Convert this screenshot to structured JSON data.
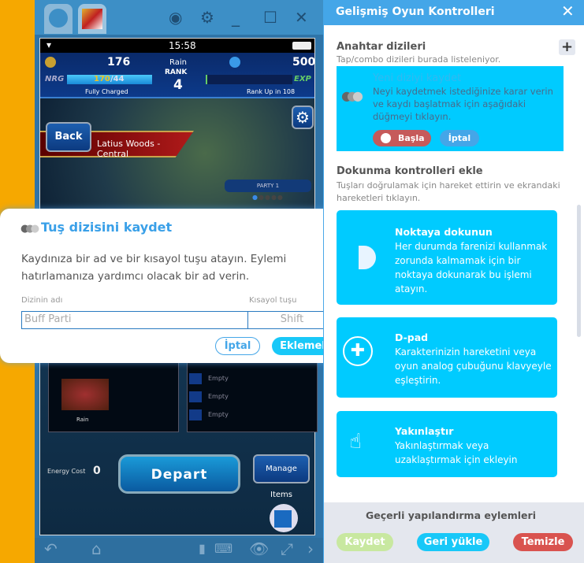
{
  "emulator": {
    "icons": [
      "home-icon",
      "app-icon",
      "account-icon",
      "gear-icon",
      "minimize-icon",
      "maximize-icon",
      "close-icon"
    ],
    "bottom_icons": [
      "back-icon",
      "home-icon",
      "location-icon",
      "keyboard-icon",
      "eye-icon",
      "fullscreen-icon",
      "chevron-right-icon"
    ]
  },
  "game": {
    "time": "15:58",
    "gil": "176",
    "player": "Rain",
    "rank_label": "RANK",
    "rank": "4",
    "gems": "500",
    "nrg_label": "NRG",
    "nrg_value": "170",
    "nrg_max": "/44",
    "nrg_status": "Fully Charged",
    "exp_label": "EXP",
    "rank_up": "Rank Up in 108",
    "back": "Back",
    "location": "Latius Woods - Central",
    "party": "PARTY 1",
    "slots": [
      "Empty",
      "Empty",
      "Empty",
      "Empty"
    ],
    "unit_name": "Rain",
    "energy_cost_label": "Energy Cost",
    "energy_cost": "0",
    "depart": "Depart",
    "manage_items": "Manage Items"
  },
  "dialog": {
    "title": "Tuş dizisini kaydet",
    "body": "Kaydınıza bir ad ve bir kısayol tuşu atayın. Eylemi hatırlamanıza yardımcı olacak bir ad verin.",
    "name_label": "Dizinin adı",
    "name_value": "Buff Parti",
    "shortcut_label": "Kısayol tuşu",
    "shortcut_value": "Shift",
    "cancel": "İptal",
    "add": "Eklemek"
  },
  "panel": {
    "title": "Gelişmiş Oyun Kontrolleri",
    "seq_title": "Anahtar dizileri",
    "seq_sub": "Tap/combo dizileri burada listeleniyor.",
    "rec_title": "Yeni diziyi kaydet",
    "rec_desc": "Neyi kaydetmek istediğinize karar verin ve kaydı başlatmak için aşağıdaki düğmeyi tıklayın.",
    "start": "Başla",
    "cancel": "İptal",
    "touch_title": "Dokunma kontrolleri ekle",
    "touch_sub": "Tuşları doğrulamak için hareket ettirin ve ekrandaki hareketleri tıklayın.",
    "cards": [
      {
        "title": "Noktaya dokunun",
        "desc": "Her durumda farenizi kullanmak zorunda kalmamak için bir noktaya dokunarak bu işlemi atayın.",
        "icon": "tap-point-icon"
      },
      {
        "title": "D-pad",
        "desc": "Karakterinizin hareketini veya oyun analog çubuğunu klavyeyle eşleştirin.",
        "icon": "dpad-icon"
      },
      {
        "title": "Yakınlaştır",
        "desc": "Yakınlaştırmak veya uzaklaştırmak için ekleyin",
        "icon": "pinch-zoom-icon"
      }
    ],
    "footer_title": "Geçerli yapılandırma eylemleri",
    "save": "Kaydet",
    "restore": "Geri yükle",
    "clear": "Temizle"
  },
  "colors": {
    "accent": "#44a6e8",
    "card": "#00cbff",
    "start": "#c65a5a",
    "save": "#c8e8a0",
    "clear": "#d9534f"
  }
}
